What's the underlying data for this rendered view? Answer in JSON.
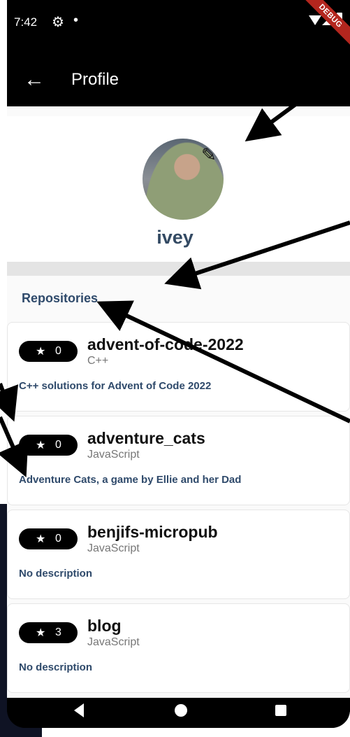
{
  "status_bar": {
    "time": "7:42",
    "debug_label": "DEBUG"
  },
  "app_bar": {
    "back_icon": "arrow-left-icon",
    "title": "Profile"
  },
  "profile": {
    "name": "ivey",
    "edit_icon": "pencil-icon"
  },
  "repositories": {
    "section_title": "Repositories",
    "items": [
      {
        "stars": "0",
        "name": "advent-of-code-2022",
        "language": "C++",
        "description": "C++ solutions for Advent of Code 2022"
      },
      {
        "stars": "0",
        "name": "adventure_cats",
        "language": "JavaScript",
        "description": "Adventure Cats, a game by Ellie and her Dad"
      },
      {
        "stars": "0",
        "name": "benjifs-micropub",
        "language": "JavaScript",
        "description": "No description"
      },
      {
        "stars": "3",
        "name": "blog",
        "language": "JavaScript",
        "description": "No description"
      }
    ]
  },
  "nav_bar": {
    "back": "nav-back-icon",
    "home": "nav-home-icon",
    "recent": "nav-recent-icon"
  },
  "colors": {
    "accent": "#2f4a6b",
    "app_bar": "#000000",
    "debug": "#b3261e"
  }
}
